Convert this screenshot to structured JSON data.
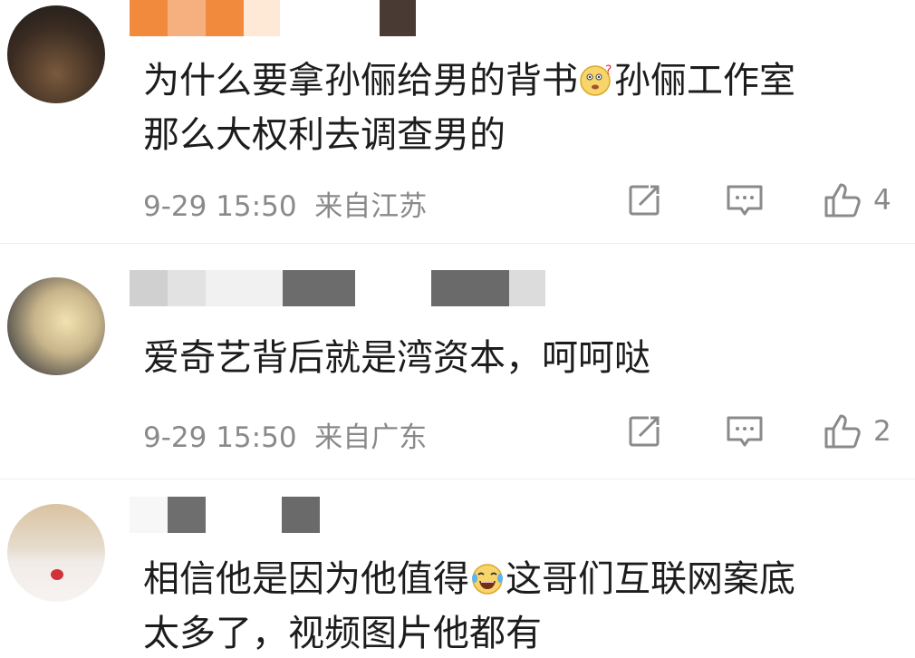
{
  "comments": [
    {
      "text_lines": [
        "为什么要拿孙俪给男的背书",
        "孙俪工作室",
        "那么大权利去调查男的"
      ],
      "emoji": "thinking-face-emoji",
      "timestamp": "9-29 15:50",
      "location": "来自江苏",
      "likes": "4"
    },
    {
      "text_lines": [
        "爱奇艺背后就是湾资本，呵呵哒"
      ],
      "timestamp": "9-29 15:50",
      "location": "来自广东",
      "likes": "2"
    },
    {
      "text_lines": [
        "相信他是因为他值得",
        "这哥们互联网案底",
        "太多了，视频图片他都有"
      ],
      "emoji": "laughing-tears-emoji"
    }
  ],
  "icons": {
    "share": "share-icon",
    "reply": "comment-icon",
    "like": "thumbs-up-icon"
  },
  "colors": {
    "meta_gray": "#8a8a8a",
    "text": "#1c1c1c",
    "blur_orange": "#f0843a"
  }
}
